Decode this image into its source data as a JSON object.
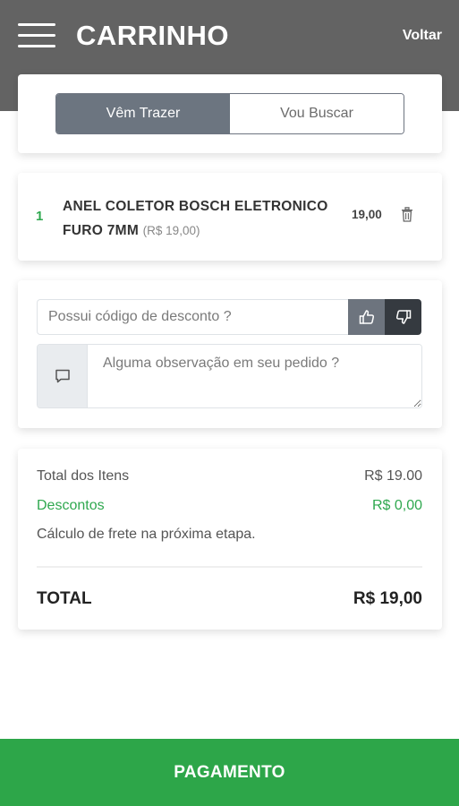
{
  "header": {
    "title": "CARRINHO",
    "back_label": "Voltar"
  },
  "delivery": {
    "options": [
      "Vêm Trazer",
      "Vou Buscar"
    ],
    "selected": "Vêm Trazer"
  },
  "cart_items": [
    {
      "qty": "1",
      "name": "ANEL COLETOR BOSCH ELETRONICO FURO 7MM",
      "unit_price": "(R$ 19,00)",
      "total": "19,00"
    }
  ],
  "coupon": {
    "placeholder": "Possui código de desconto ?"
  },
  "observation": {
    "placeholder": "Alguma observação em seu pedido ?"
  },
  "totals": {
    "items_label": "Total dos Itens",
    "items_value": "R$ 19.00",
    "discount_label": "Descontos",
    "discount_value": "R$ 0,00",
    "freight_note": "Cálculo de frete na próxima etapa.",
    "total_label": "TOTAL",
    "total_value": "R$ 19,00"
  },
  "footer": {
    "pay_label": "PAGAMENTO"
  },
  "colors": {
    "header_bg": "#636363",
    "accent_green": "#2da649",
    "toggle_active": "#6c7580"
  }
}
